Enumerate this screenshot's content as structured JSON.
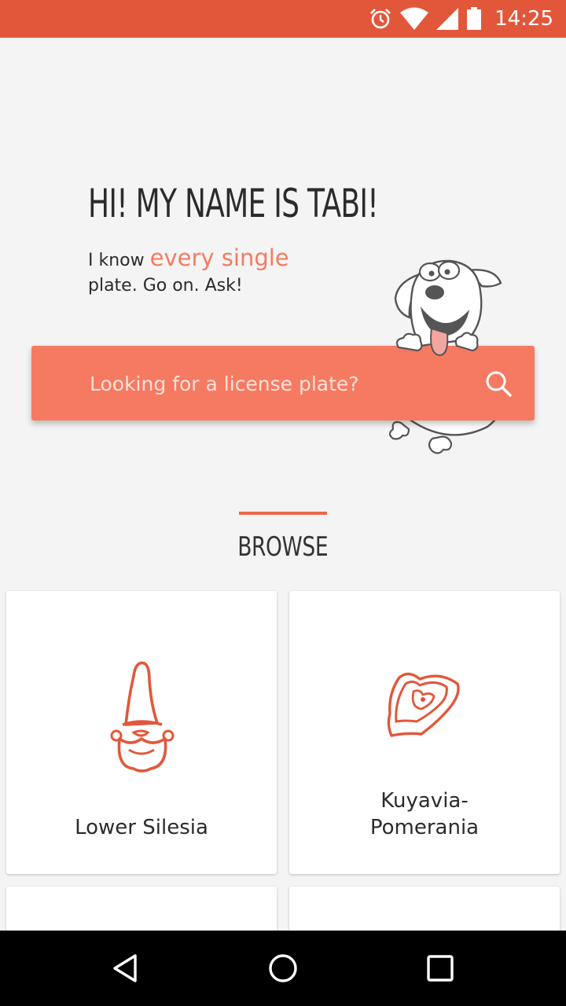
{
  "status_bar": {
    "time": "14:25",
    "background": "#e2573a",
    "icons": [
      "alarm-icon",
      "wifi-icon",
      "signal-icon",
      "battery-icon"
    ],
    "battery_level": "56"
  },
  "hero": {
    "title": "HI! MY NAME IS TABI!",
    "tagline_prefix": "I know ",
    "tagline_accent": "every single",
    "tagline_suffix": "plate. Go on. Ask!"
  },
  "search": {
    "placeholder": "Looking for a license plate?",
    "value": "",
    "color": "#f67a62"
  },
  "browse": {
    "label": "BROWSE",
    "accent_color": "#e9694c"
  },
  "cards": [
    {
      "title": "Lower Silesia",
      "icon": "gnome-icon"
    },
    {
      "title": "Kuyavia-\nPomerania",
      "icon": "heart-gingerbread-icon"
    },
    {
      "title": "",
      "icon": ""
    },
    {
      "title": "",
      "icon": ""
    }
  ],
  "nav": {
    "buttons": [
      "back-icon",
      "home-icon",
      "recents-icon"
    ]
  }
}
